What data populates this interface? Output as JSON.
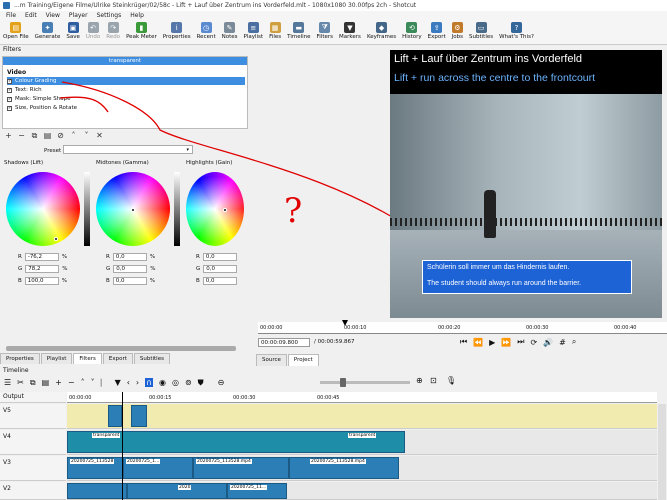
{
  "window": {
    "title": "...m Training/Eigene Filme/Ulrike Steinkrüger/02/58c - Lift + Lauf über Zentrum ins Vorderfeld.mlt - 1080x1080 30.00fps 2ch - Shotcut"
  },
  "menu": [
    "File",
    "Edit",
    "View",
    "Player",
    "Settings",
    "Help"
  ],
  "toolbar": [
    {
      "label": "Open File",
      "icon": "folder-icon",
      "color": "#e3a21a"
    },
    {
      "label": "Generate",
      "icon": "generate-icon",
      "color": "#4a7fb5"
    },
    {
      "label": "Save",
      "icon": "save-icon",
      "color": "#2f5ea0"
    },
    {
      "label": "Undo",
      "icon": "undo-icon",
      "color": "#9aa4ad"
    },
    {
      "label": "Redo",
      "icon": "redo-icon",
      "color": "#9aa4ad"
    },
    {
      "label": "Peak Meter",
      "icon": "peak-meter-icon",
      "color": "#3a9a3a"
    },
    {
      "label": "Properties",
      "icon": "properties-icon",
      "color": "#5577aa"
    },
    {
      "label": "Recent",
      "icon": "recent-icon",
      "color": "#5a8ad0"
    },
    {
      "label": "Notes",
      "icon": "notes-icon",
      "color": "#7a8a99"
    },
    {
      "label": "Playlist",
      "icon": "playlist-icon",
      "color": "#4a6fa0"
    },
    {
      "label": "Files",
      "icon": "files-icon",
      "color": "#d0a040"
    },
    {
      "label": "Timeline",
      "icon": "timeline-icon",
      "color": "#557799"
    },
    {
      "label": "Filters",
      "icon": "filters-icon",
      "color": "#6688aa"
    },
    {
      "label": "Markers",
      "icon": "markers-icon",
      "color": "#333333"
    },
    {
      "label": "Keyframes",
      "icon": "keyframes-icon",
      "color": "#446688"
    },
    {
      "label": "History",
      "icon": "history-icon",
      "color": "#3a8a5a"
    },
    {
      "label": "Export",
      "icon": "export-icon",
      "color": "#3a7ac0"
    },
    {
      "label": "Jobs",
      "icon": "jobs-icon",
      "color": "#c07a2a"
    },
    {
      "label": "Subtitles",
      "icon": "subtitles-icon",
      "color": "#4a6a8a"
    },
    {
      "label": "What's This?",
      "icon": "help-icon",
      "color": "#336699"
    }
  ],
  "filters": {
    "panel_title": "Filters",
    "clip_name": "transparent",
    "section": "Video",
    "items": [
      {
        "label": "Colour Grading",
        "checked": "✓"
      },
      {
        "label": "Text: Rich",
        "checked": "✓"
      },
      {
        "label": "Mask: Simple Shape",
        "checked": "✓"
      },
      {
        "label": "Size, Position & Rotate",
        "checked": "✓"
      }
    ],
    "preset_label": "Preset",
    "preset_value": "▾"
  },
  "grading": {
    "wheels": [
      {
        "title": "Shadows (Lift)",
        "r": "-76,2",
        "g": "78,2",
        "b": "100,0"
      },
      {
        "title": "Midtones (Gamma)",
        "r": "0,0",
        "g": "0,0",
        "b": "0,0"
      },
      {
        "title": "Highlights (Gain)",
        "r": "0,0",
        "g": "0,0",
        "b": "0,0"
      }
    ],
    "unit": "%",
    "channel_labels": {
      "r": "R",
      "g": "G",
      "b": "B"
    }
  },
  "annotation": {
    "question": "?",
    "color": "#e00000"
  },
  "left_tabs": [
    "Properties",
    "Playlist",
    "Filters",
    "Export",
    "Subtitles"
  ],
  "preview": {
    "title_de": "Lift + Lauf über Zentrum ins Vorderfeld",
    "title_en": "Lift + run across the centre to the frontcourt",
    "caption_de": "Schülerin soll immer um das Hindernis laufen.",
    "caption_en": "The student should always run around the barrier."
  },
  "player": {
    "ruler_ticks": [
      "00:00:00",
      "00:00:10",
      "00:00:20",
      "00:00:30",
      "00:00:40"
    ],
    "timecode": "00:00:09.800",
    "duration": "/ 00:00:59.867",
    "tabs": [
      "Source",
      "Project"
    ]
  },
  "timeline": {
    "title": "Timeline",
    "ruler_ticks": [
      "00:00:00",
      "00:00:15",
      "00:00:30",
      "00:00:45"
    ],
    "output_label": "Output",
    "tracks": [
      {
        "name": "V5"
      },
      {
        "name": "V4",
        "clip_a": "transparent",
        "clip_b": "transparent"
      },
      {
        "name": "V3",
        "clip_a": "20200725_113528",
        "clip_b": "20200725_1...",
        "clip_c": "20200725_113528.mp4",
        "clip_d": "20200725_113528.mp4"
      },
      {
        "name": "V2",
        "clip_a": "20200725_11...",
        "clip_b": "2020"
      }
    ]
  }
}
